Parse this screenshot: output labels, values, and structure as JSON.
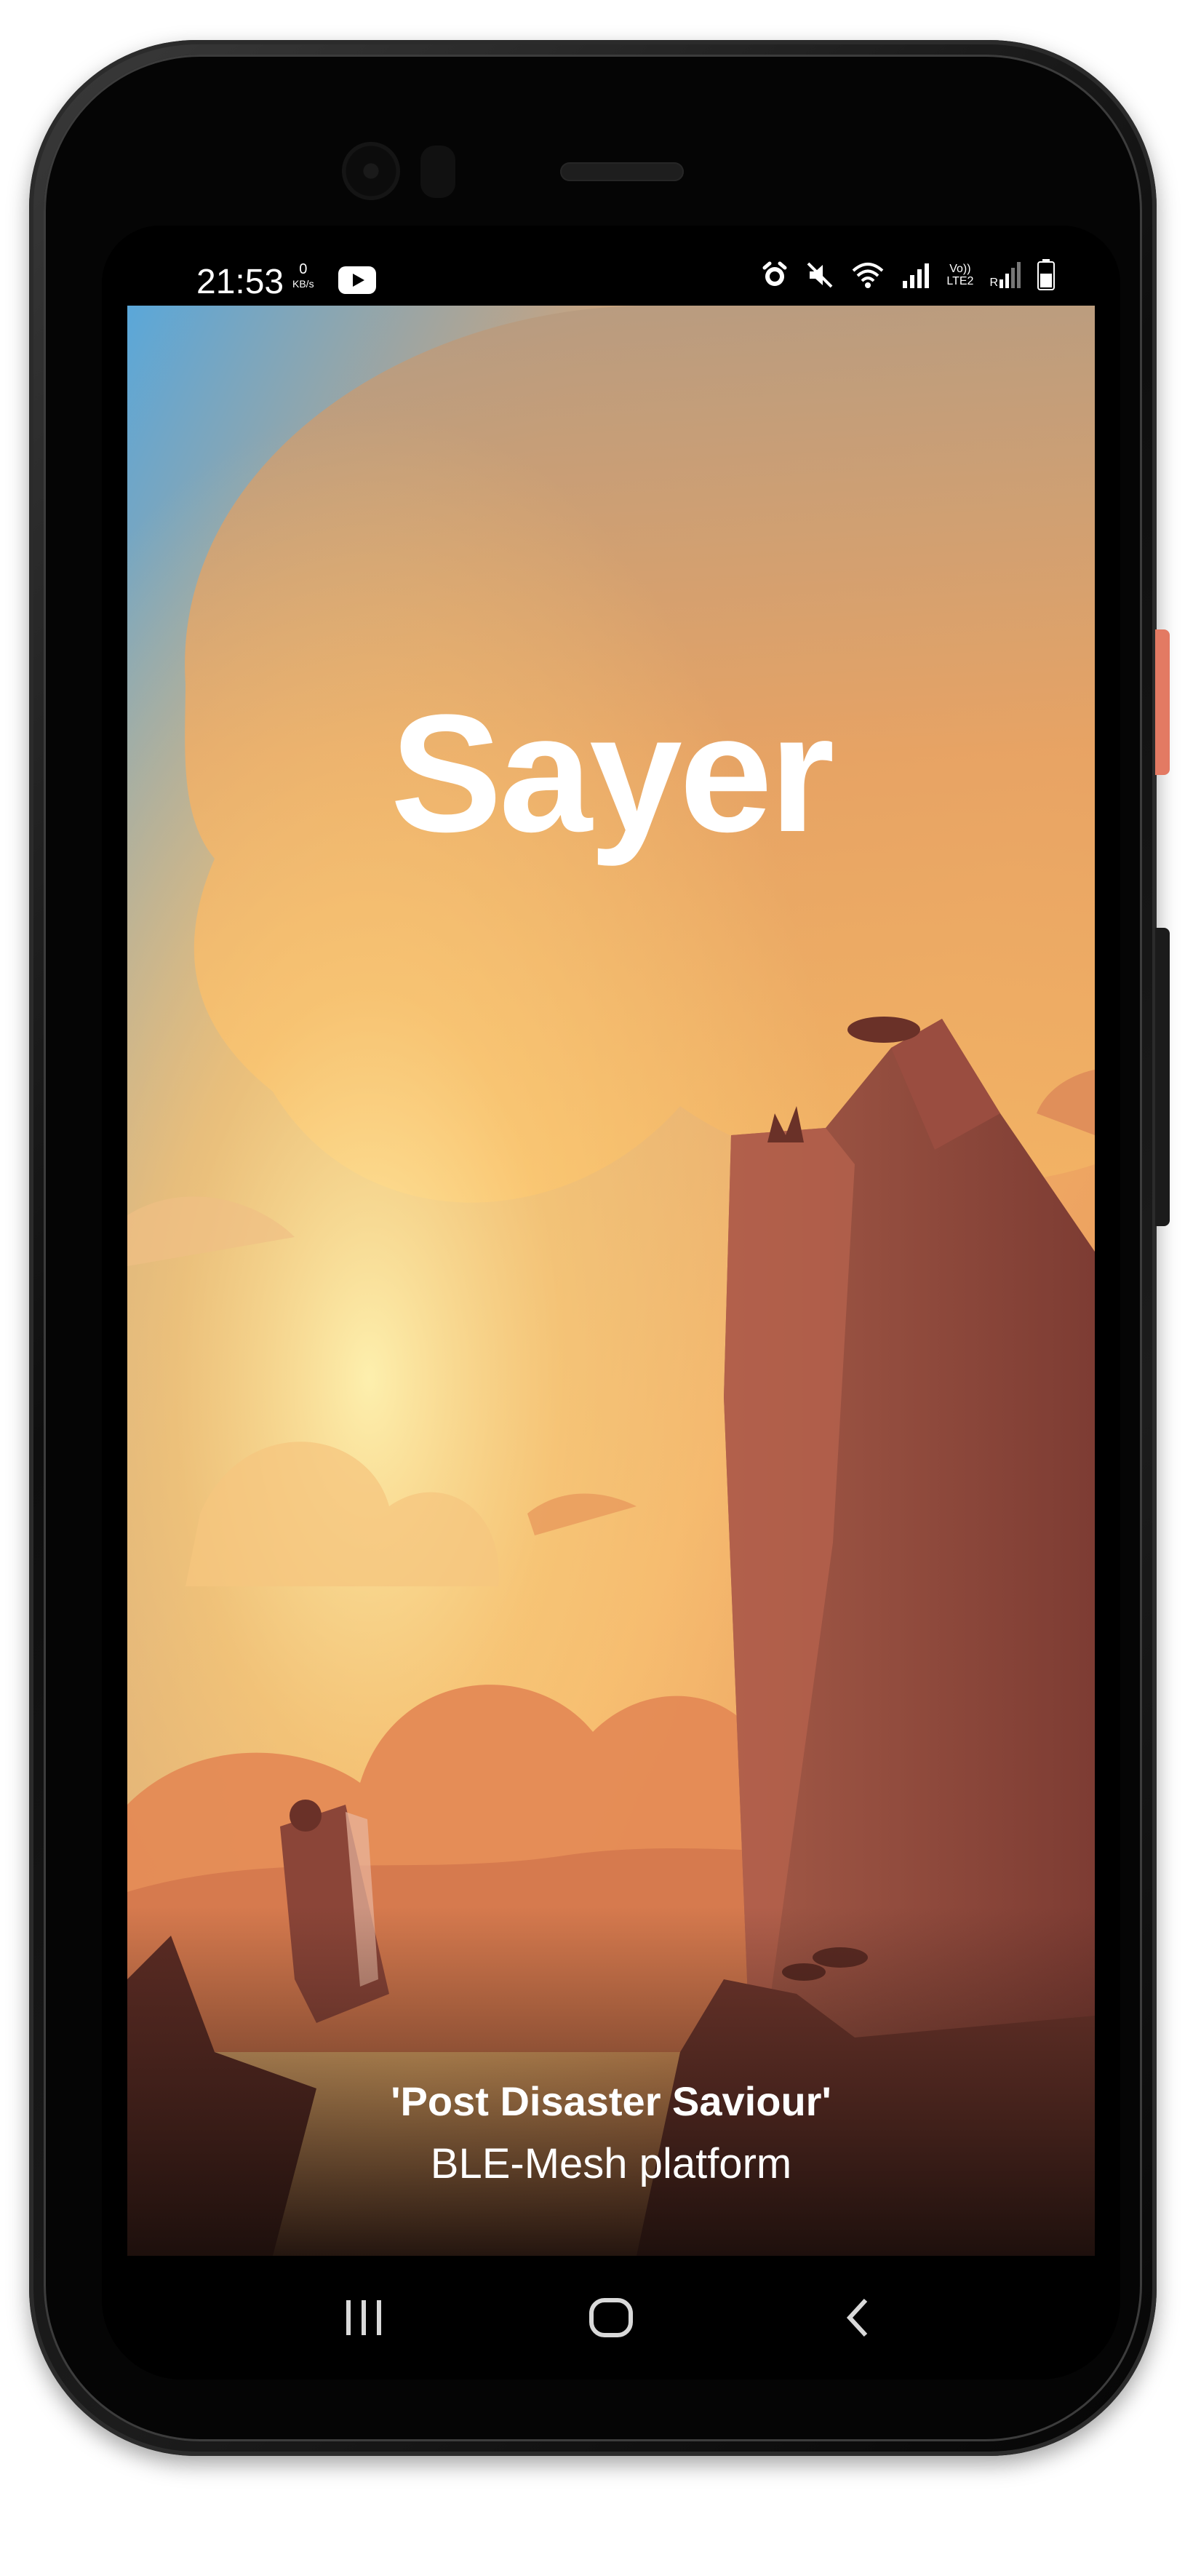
{
  "status_bar": {
    "time": "21:53",
    "net_speed_value": "0",
    "net_speed_unit": "KB/s",
    "left_icons": [
      "youtube-icon"
    ],
    "right_icons": [
      "alarm-icon",
      "mute-icon",
      "wifi-icon",
      "signal-icon",
      "volte-lte2-icon",
      "roaming-signal-icon",
      "battery-icon"
    ],
    "lte_label_top": "Vo))",
    "lte_label_bottom": "LTE2",
    "roaming_label": "R"
  },
  "splash": {
    "app_name": "Sayer",
    "tagline": "'Post Disaster Saviour'",
    "subtitle": "BLE-Mesh platform"
  },
  "nav_bar": {
    "buttons": [
      "recent-apps-icon",
      "home-icon",
      "back-icon"
    ]
  },
  "colors": {
    "phone_body": "#0e0e0e",
    "side_button_accent": "#e37a63",
    "sky_top": "#6fb3d6",
    "sunset_orange": "#f0a55e",
    "rock": "#8f4a3e",
    "foreground_dark": "#2a1612"
  }
}
